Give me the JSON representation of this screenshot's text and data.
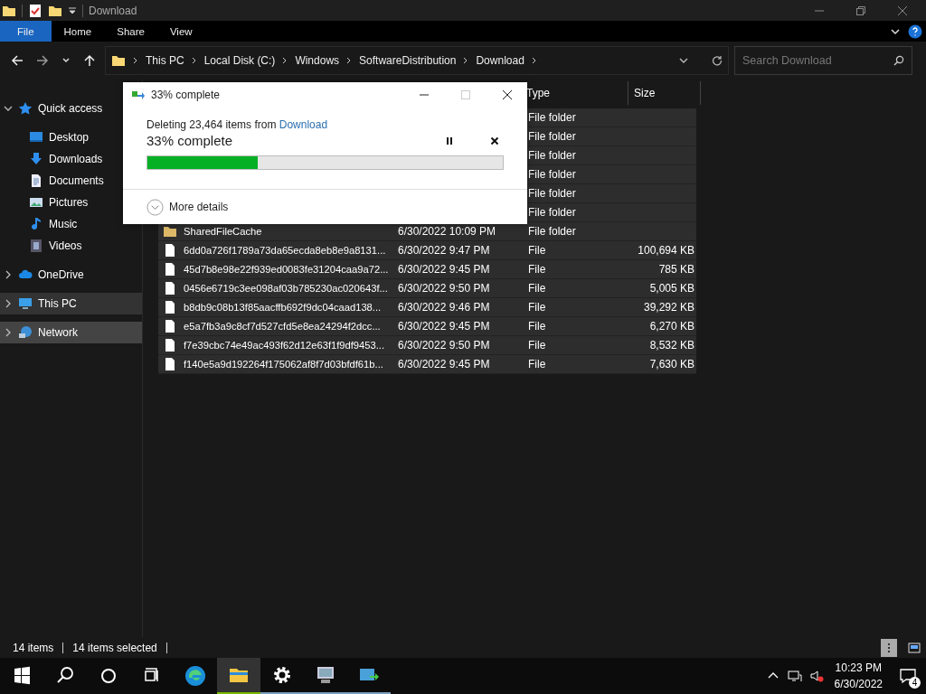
{
  "window": {
    "title": "Download"
  },
  "ribbon_tabs": [
    {
      "label": "File",
      "selected": true
    },
    {
      "label": "Home",
      "selected": false
    },
    {
      "label": "Share",
      "selected": false
    },
    {
      "label": "View",
      "selected": false
    }
  ],
  "address": {
    "crumbs": [
      "This PC",
      "Local Disk (C:)",
      "Windows",
      "SoftwareDistribution",
      "Download"
    ]
  },
  "search": {
    "placeholder": "Search Download"
  },
  "sidebar": {
    "items": [
      {
        "label": "Quick access",
        "kind": "star",
        "expanded": true,
        "selected": false,
        "hovered": false,
        "children": [
          {
            "label": "Desktop",
            "kind": "desktop",
            "selected": false,
            "hovered": false
          },
          {
            "label": "Downloads",
            "kind": "download",
            "selected": false,
            "hovered": false
          },
          {
            "label": "Documents",
            "kind": "document",
            "selected": false,
            "hovered": false
          },
          {
            "label": "Pictures",
            "kind": "pictures",
            "selected": false,
            "hovered": false
          },
          {
            "label": "Music",
            "kind": "music",
            "selected": false,
            "hovered": false
          },
          {
            "label": "Videos",
            "kind": "videos",
            "selected": false,
            "hovered": false
          }
        ]
      },
      {
        "label": "OneDrive",
        "kind": "cloud",
        "expanded": false,
        "selected": false,
        "hovered": false
      },
      {
        "label": "This PC",
        "kind": "pc",
        "expanded": false,
        "selected": true,
        "hovered": false
      },
      {
        "label": "Network",
        "kind": "network",
        "expanded": false,
        "selected": false,
        "hovered": true
      }
    ]
  },
  "table": {
    "columns": [
      {
        "label": "Type"
      },
      {
        "label": "Size"
      }
    ],
    "rows": [
      {
        "type": "File folder",
        "selected": true
      },
      {
        "type": "File folder",
        "selected": true
      },
      {
        "type": "File folder",
        "selected": true
      },
      {
        "type": "File folder",
        "selected": true
      },
      {
        "type": "File folder",
        "selected": true
      },
      {
        "type": "File folder",
        "selected": true
      },
      {
        "kind": "folder",
        "name": "SharedFileCache",
        "date": "6/30/2022 10:09 PM",
        "type": "File folder",
        "selected": true
      },
      {
        "kind": "file",
        "name": "6dd0a726f1789a73da65ecda8eb8e9a8131...",
        "date": "6/30/2022 9:47 PM",
        "type": "File",
        "size": "100,694 KB",
        "selected": true
      },
      {
        "kind": "file",
        "name": "45d7b8e98e22f939ed0083fe31204caa9a72...",
        "date": "6/30/2022 9:45 PM",
        "type": "File",
        "size": "785 KB",
        "selected": true
      },
      {
        "kind": "file",
        "name": "0456e6719c3ee098af03b785230ac020643f...",
        "date": "6/30/2022 9:50 PM",
        "type": "File",
        "size": "5,005 KB",
        "selected": true
      },
      {
        "kind": "file",
        "name": "b8db9c08b13f85aacffb692f9dc04caad138...",
        "date": "6/30/2022 9:46 PM",
        "type": "File",
        "size": "39,292 KB",
        "selected": true
      },
      {
        "kind": "file",
        "name": "e5a7fb3a9c8cf7d527cfd5e8ea24294f2dcc...",
        "date": "6/30/2022 9:45 PM",
        "type": "File",
        "size": "6,270 KB",
        "selected": true
      },
      {
        "kind": "file",
        "name": "f7e39cbc74e49ac493f62d12e63f1f9df9453...",
        "date": "6/30/2022 9:50 PM",
        "type": "File",
        "size": "8,532 KB",
        "selected": true
      },
      {
        "kind": "file",
        "name": "f140e5a9d192264f175062af8f7d03bfdf61b...",
        "date": "6/30/2022 9:45 PM",
        "type": "File",
        "size": "7,630 KB",
        "selected": true
      }
    ]
  },
  "status_bar": {
    "count": "14 items",
    "selection": "14 items selected"
  },
  "dialog": {
    "title": "33% complete",
    "message_prefix": "Deleting 23,464 items from ",
    "source_link": "Download",
    "heading": "33% complete",
    "level": 0.31,
    "details": "More details"
  },
  "taskbar": {
    "items": [
      {
        "kind": "edge",
        "running": false,
        "active": false
      },
      {
        "kind": "explorer",
        "running": true,
        "active": true
      },
      {
        "kind": "settings",
        "running": true,
        "active": false
      },
      {
        "kind": "monitor",
        "running": true,
        "active": false
      },
      {
        "kind": "transfer",
        "running": true,
        "active": false
      }
    ],
    "time": "10:23 PM",
    "date": "6/30/2022",
    "notifications": "4"
  }
}
